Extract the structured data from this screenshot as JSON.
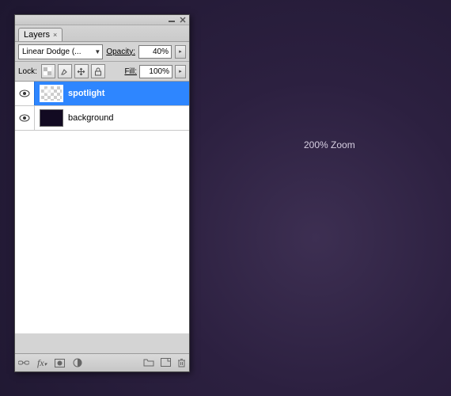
{
  "canvas": {
    "zoom_label": "200% Zoom"
  },
  "panel": {
    "tab": "Layers",
    "blend_mode": "Linear Dodge (...",
    "opacity_label": "Opacity:",
    "opacity_value": "40%",
    "lock_label": "Lock:",
    "fill_label": "Fill:",
    "fill_value": "100%"
  },
  "layers": [
    {
      "name": "spotlight",
      "visible": true,
      "selected": true,
      "thumb": "checker"
    },
    {
      "name": "background",
      "visible": true,
      "selected": false,
      "thumb": "dark"
    }
  ]
}
